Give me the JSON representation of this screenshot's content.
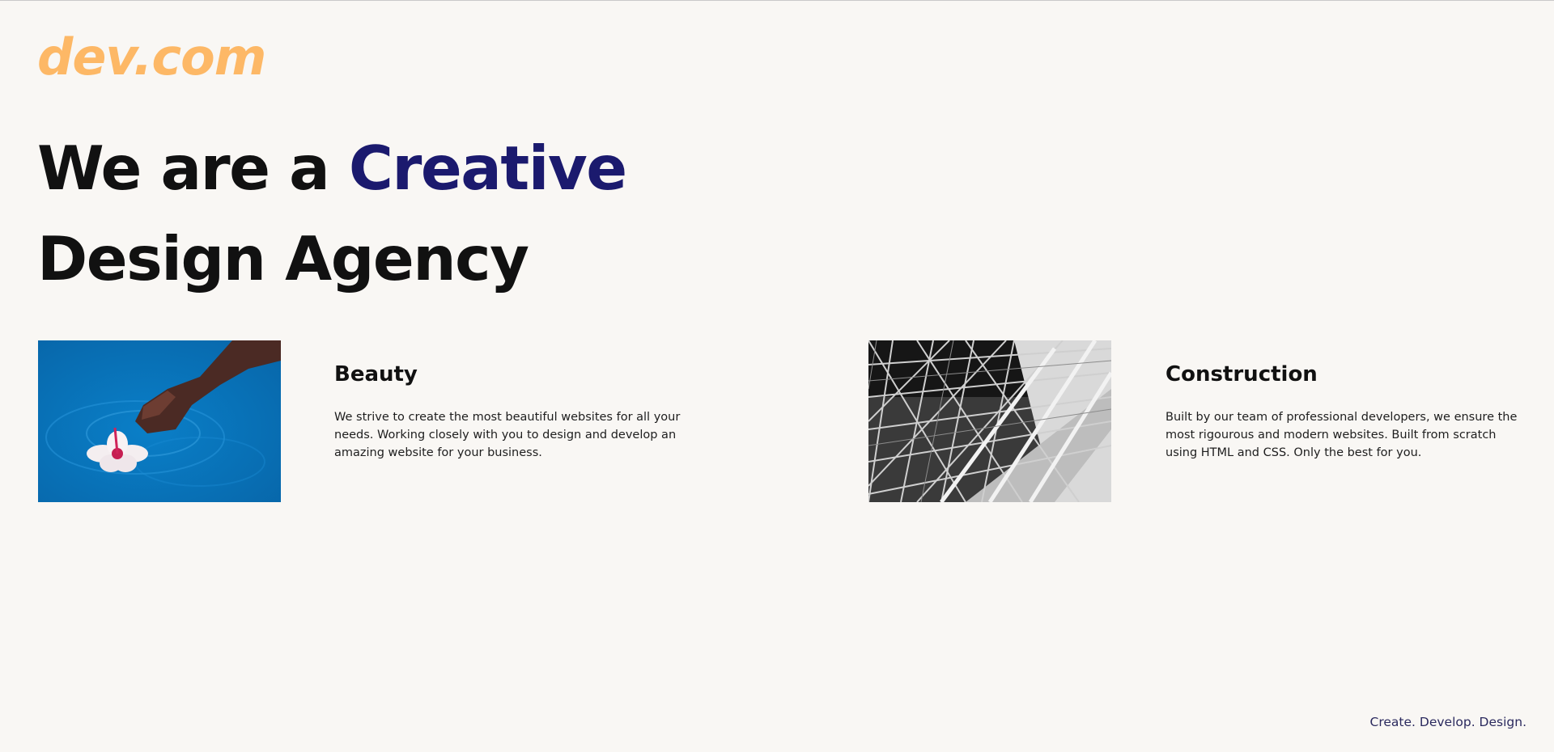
{
  "brand": {
    "logo_text": "dev.com",
    "logo_color": "#fdb866"
  },
  "hero": {
    "line1_prefix": "We are a",
    "line1_highlight": "Creative",
    "line2": "Design Agency",
    "highlight_color": "#1b1a6e"
  },
  "services": [
    {
      "title": "Beauty",
      "text": "We strive to create the most beautiful websites for all your needs. Working closely with you to design and develop an amazing website for your business.",
      "image": "photo of a hand placing a hibiscus flower on blue water"
    },
    {
      "title": "Construction",
      "text": "Built by our team of professional developers, we ensure the most rigourous and modern websites. Built from scratch using HTML and CSS. Only the best for you.",
      "image": "black and white photo of steel truss structure"
    }
  ],
  "footer": {
    "tagline": "Create. Develop. Design.",
    "color": "#2b2a5e"
  }
}
